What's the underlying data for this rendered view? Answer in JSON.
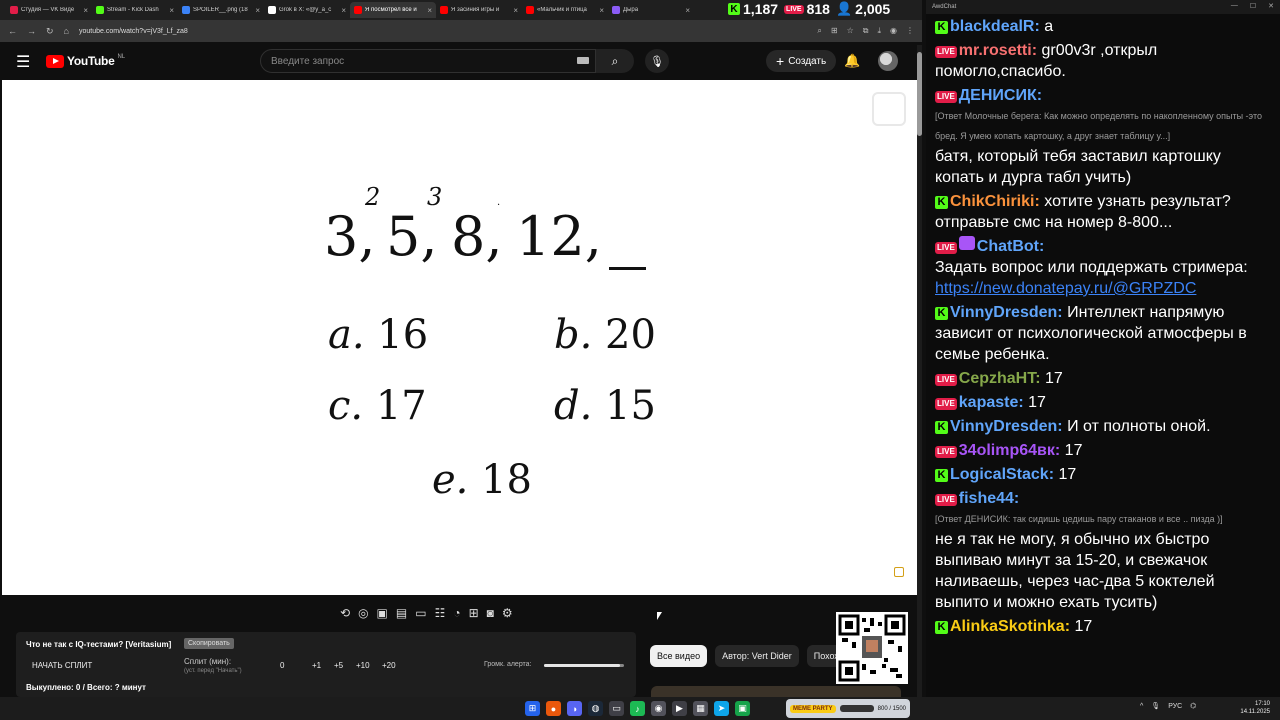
{
  "browser": {
    "tabs": [
      {
        "label": "Студия — VK Виде",
        "color": "#e11d48",
        "active": false
      },
      {
        "label": "Stream - Kick Dash",
        "color": "#53fc18",
        "active": false
      },
      {
        "label": "SPOILER__.png (18",
        "color": "#3b82f6",
        "active": false
      },
      {
        "label": "Grok в X: «@y_a_c",
        "color": "#ffffff",
        "active": false
      },
      {
        "label": "Я посмотрел все и",
        "color": "#ff0000",
        "active": true
      },
      {
        "label": "Я засиния игры и",
        "color": "#ff0000",
        "active": false
      },
      {
        "label": "«Мальчик и птица",
        "color": "#ff0000",
        "active": false
      },
      {
        "label": "Дыра",
        "color": "#8b5cf6",
        "active": false
      }
    ],
    "url": "youtube.com/watch?v=jV3f_Lf_za8",
    "stats": {
      "kick": "1,187",
      "vk": "818",
      "total": "2,005"
    }
  },
  "youtube": {
    "logo": "YouTube",
    "region": "NL",
    "search_placeholder": "Введите запрос",
    "create_label": "Создать"
  },
  "video": {
    "sequence": [
      "3,",
      "5,",
      "8,",
      "12,"
    ],
    "sequence_sups": [
      "2",
      "3"
    ],
    "choices": [
      {
        "letter": "a.",
        "value": "16"
      },
      {
        "letter": "b.",
        "value": "20"
      },
      {
        "letter": "c.",
        "value": "17"
      },
      {
        "letter": "d.",
        "value": "15"
      },
      {
        "letter": "e.",
        "value": "18"
      }
    ]
  },
  "widget": {
    "title": "Что не так с IQ-тестами? [Veritasium]",
    "copy": "Скопировать",
    "start": "НАЧАТЬ СПЛИТ",
    "split_label": "Сплит (мин):",
    "split_sub": "(уст. перед \"Начать\")",
    "steps": [
      "0",
      "+1",
      "+5",
      "+10",
      "+20"
    ],
    "alert_label": "Громк. алерта:",
    "alert_volume": 0.95,
    "bought": "Выкуплено: 0 / Всего: ? минут"
  },
  "chips": [
    "Все видео",
    "Автор: Vert Dider",
    "Похожие"
  ],
  "chat": {
    "title": "AwdChat",
    "messages": [
      {
        "platform": "kick",
        "user": "blackdealR:",
        "color": "#60a5fa",
        "text": "а"
      },
      {
        "platform": "vk",
        "user": "mr.rosetti:",
        "color": "#f87171",
        "text": "gr00v3r ,открыл помогло,спасибо."
      },
      {
        "platform": "vk",
        "user": "ДЕНИСИК:",
        "color": "#60a5fa",
        "reply": "[Ответ Молочные берега: Как можно определять по накопленному опыты -это бред. Я умею копать картошку, а друг знает таблицу у...]",
        "text": "батя, который тебя заставил картошку копать и дурга табл учить)"
      },
      {
        "platform": "kick",
        "user": "ChikChiriki:",
        "color": "#fb923c",
        "text": "хотите узнать результат? отправьте смс на номер 8-800..."
      },
      {
        "platform": "vk",
        "user": "ChatBot:",
        "color": "#60a5fa",
        "bot": true,
        "text": "Задать вопрос или поддержать стримера:",
        "link": "https://new.donatepay.ru/@GRPZDC"
      },
      {
        "platform": "kick",
        "user": "VinnyDresden:",
        "color": "#60a5fa",
        "text": "Интеллект напрямую зависит от психологической атмосферы в семье ребенка."
      },
      {
        "platform": "vk",
        "user": "CepzhaHT:",
        "color": "#86a84a",
        "text": "17"
      },
      {
        "platform": "vk",
        "user": "kapaste:",
        "color": "#60a5fa",
        "text": "17"
      },
      {
        "platform": "kick",
        "user": "VinnyDresden:",
        "color": "#60a5fa",
        "text": "И от полноты оной."
      },
      {
        "platform": "vk",
        "user": "34olimp64вк:",
        "color": "#a855f7",
        "text": "17"
      },
      {
        "platform": "kick",
        "user": "LogicalStack:",
        "color": "#60a5fa",
        "text": "17"
      },
      {
        "platform": "vk",
        "user": "fishe44:",
        "color": "#60a5fa",
        "reply": "[Ответ ДЕНИСИК: так сидишь цедишь пару стаканов и все .. пизда )]",
        "text": "не я так не могу, я обычно их быстро выпиваю минут за 15-20, и свежачок наливаешь, через час-два 5 коктелей выпито и можно ехать тусить)"
      },
      {
        "platform": "kick",
        "user": "AlinkaSkotinka:",
        "color": "#facc15",
        "text": "17"
      }
    ]
  },
  "taskbar": {
    "meme_label": "MEME PARTY",
    "meme_count": "800 / 1500",
    "lang": "РУС",
    "time": "17:10",
    "date": "14.11.2025"
  }
}
